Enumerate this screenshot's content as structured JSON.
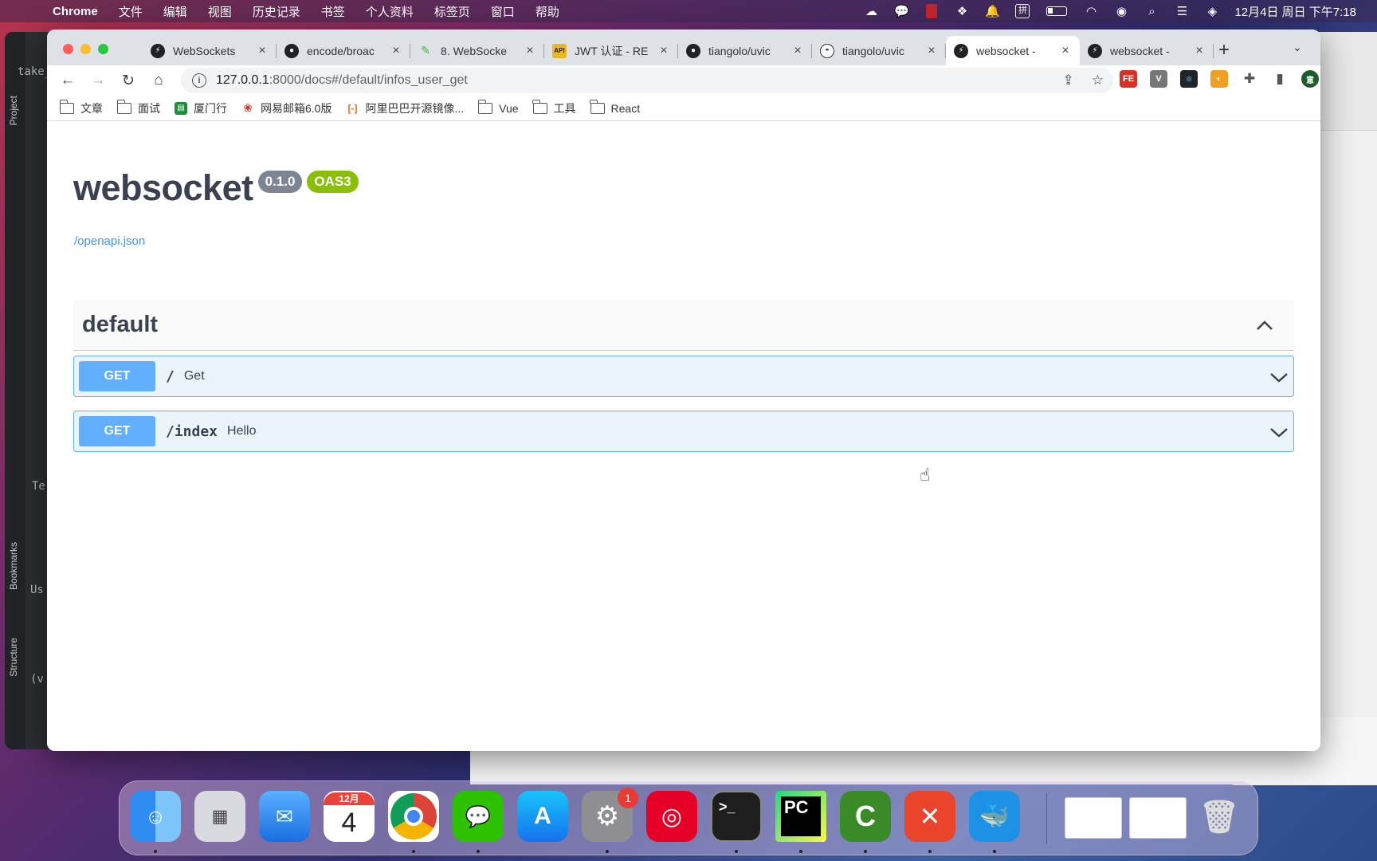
{
  "menubar": {
    "app_name": "Chrome",
    "items": [
      "文件",
      "编辑",
      "视图",
      "历史记录",
      "书签",
      "个人资料",
      "标签页",
      "窗口",
      "帮助"
    ],
    "clock": "12月4日 周日 下午7:18"
  },
  "ide": {
    "label_project": "Project",
    "label_bookmarks": "Bookmarks",
    "label_structure": "Structure",
    "text_take": "take_",
    "text_te": "Te",
    "text_us": "Us",
    "text_v": "(v"
  },
  "tabs": [
    {
      "title": "WebSockets",
      "favicon": "fastapi-icon",
      "color": "#202124"
    },
    {
      "title": "encode/broac",
      "favicon": "github-icon",
      "color": "#202124"
    },
    {
      "title": "8. WebSocke",
      "favicon": "feather-icon",
      "color": "#4caf50"
    },
    {
      "title": "JWT 认证 - RE",
      "favicon": "api-icon",
      "color": "#e8b923"
    },
    {
      "title": "tiangolo/uvic",
      "favicon": "github-icon",
      "color": "#202124"
    },
    {
      "title": "tiangolo/uvic",
      "favicon": "unicorn-icon",
      "color": "#333333"
    },
    {
      "title": "websocket -",
      "favicon": "fastapi-icon",
      "color": "#202124"
    },
    {
      "title": "websocket -",
      "favicon": "fastapi-icon",
      "color": "#202124"
    }
  ],
  "active_tab_index": 6,
  "address": {
    "host": "127.0.0.1",
    "path": ":8000/docs#/default/infos_user_get"
  },
  "extensions": [
    {
      "label": "FE",
      "color": "#d93025"
    },
    {
      "label": "V",
      "color": "#777777"
    },
    {
      "label": "⚛",
      "color": "#20232a"
    },
    {
      "label": "◐",
      "color": "#f0a020"
    },
    {
      "label": "✚",
      "color": "#555555"
    },
    {
      "label": "▮",
      "color": "#555555"
    },
    {
      "label": "意",
      "color": "#1e5d2a"
    }
  ],
  "bookmarks": [
    {
      "label": "文章",
      "type": "folder"
    },
    {
      "label": "面试",
      "type": "folder"
    },
    {
      "label": "厦门行",
      "type": "sheet",
      "color": "#1e8e3e",
      "glyph": "▤"
    },
    {
      "label": "网易邮箱6.0版",
      "type": "site",
      "color": "#d93025",
      "glyph": "❀"
    },
    {
      "label": "阿里巴巴开源镜像...",
      "type": "site",
      "color": "#ff6a00",
      "glyph": "[-]"
    },
    {
      "label": "Vue",
      "type": "folder"
    },
    {
      "label": "工具",
      "type": "folder"
    },
    {
      "label": "React",
      "type": "folder"
    }
  ],
  "swagger": {
    "title": "websocket",
    "version": "0.1.0",
    "oas": "OAS3",
    "openapi_link": "/openapi.json",
    "tag": "default",
    "operations": [
      {
        "method": "GET",
        "path": "/",
        "summary": "Get"
      },
      {
        "method": "GET",
        "path": "/index",
        "summary": "Hello"
      }
    ]
  },
  "colors": {
    "get_method": "#61affe",
    "get_bg": "#ebf3fb",
    "oas_badge": "#89bf04",
    "version_badge": "#7d8492",
    "link": "#4990e2"
  },
  "dock": {
    "calendar_month": "12月",
    "calendar_day": "4",
    "settings_badge": "1",
    "apps": [
      "finder-icon",
      "launchpad-icon",
      "mail-icon",
      "calendar-icon",
      "chrome-icon",
      "wechat-icon",
      "app-store-icon",
      "system-settings-icon",
      "netease-music-icon",
      "terminal-icon",
      "pycharm-icon",
      "camtasia-icon",
      "xmind-icon",
      "docker-icon",
      "trash-icon"
    ]
  }
}
